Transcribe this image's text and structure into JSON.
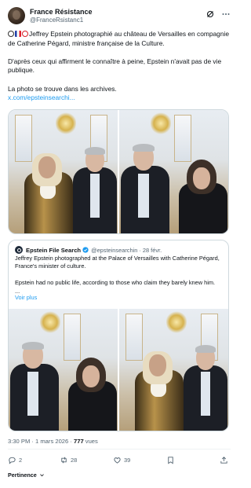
{
  "author": {
    "name": "France Résistance",
    "handle": "@FranceRsistanc1"
  },
  "post": {
    "line1": "Jeffrey Epstein photographié au château de Versailles en compagnie de Catherine Pégard, ministre française de la Culture.",
    "line2": "D'après ceux qui affirment le connaître à peine, Epstein n'avait pas de vie publique.",
    "line3": "La photo se trouve dans les archives.",
    "link": "x.com/epsteinsearchi..."
  },
  "quoted": {
    "name": "Epstein File Search",
    "handle": "@epsteinsearchin · 28 févr.",
    "line1": "Jeffrey Epstein photographed at the Palace of Versailles with Catherine Pégard, France's minister of culture.",
    "line2": "Epstein had no public life, according to those who claim they barely knew him.",
    "ellipsis": "...",
    "show_more": "Voir plus"
  },
  "meta": {
    "timestamp": "3:30 PM · 1 mars 2026 · ",
    "views_count": "777",
    "views_label": " vues"
  },
  "actions": {
    "replies": "2",
    "reposts": "28",
    "likes": "39"
  },
  "footer": {
    "sort_label": "Pertinence"
  },
  "colors": {
    "accent": "#1d9bf0",
    "text": "#0f1419",
    "muted": "#536471",
    "border": "#cfd9de"
  },
  "icons": [
    "grok-icon",
    "more-icon",
    "search-emoji",
    "france-flag-emoji",
    "alarm-emoji",
    "verified-badge-icon",
    "reply-icon",
    "repost-icon",
    "like-icon",
    "bookmark-icon",
    "share-icon",
    "chevron-down-icon"
  ]
}
